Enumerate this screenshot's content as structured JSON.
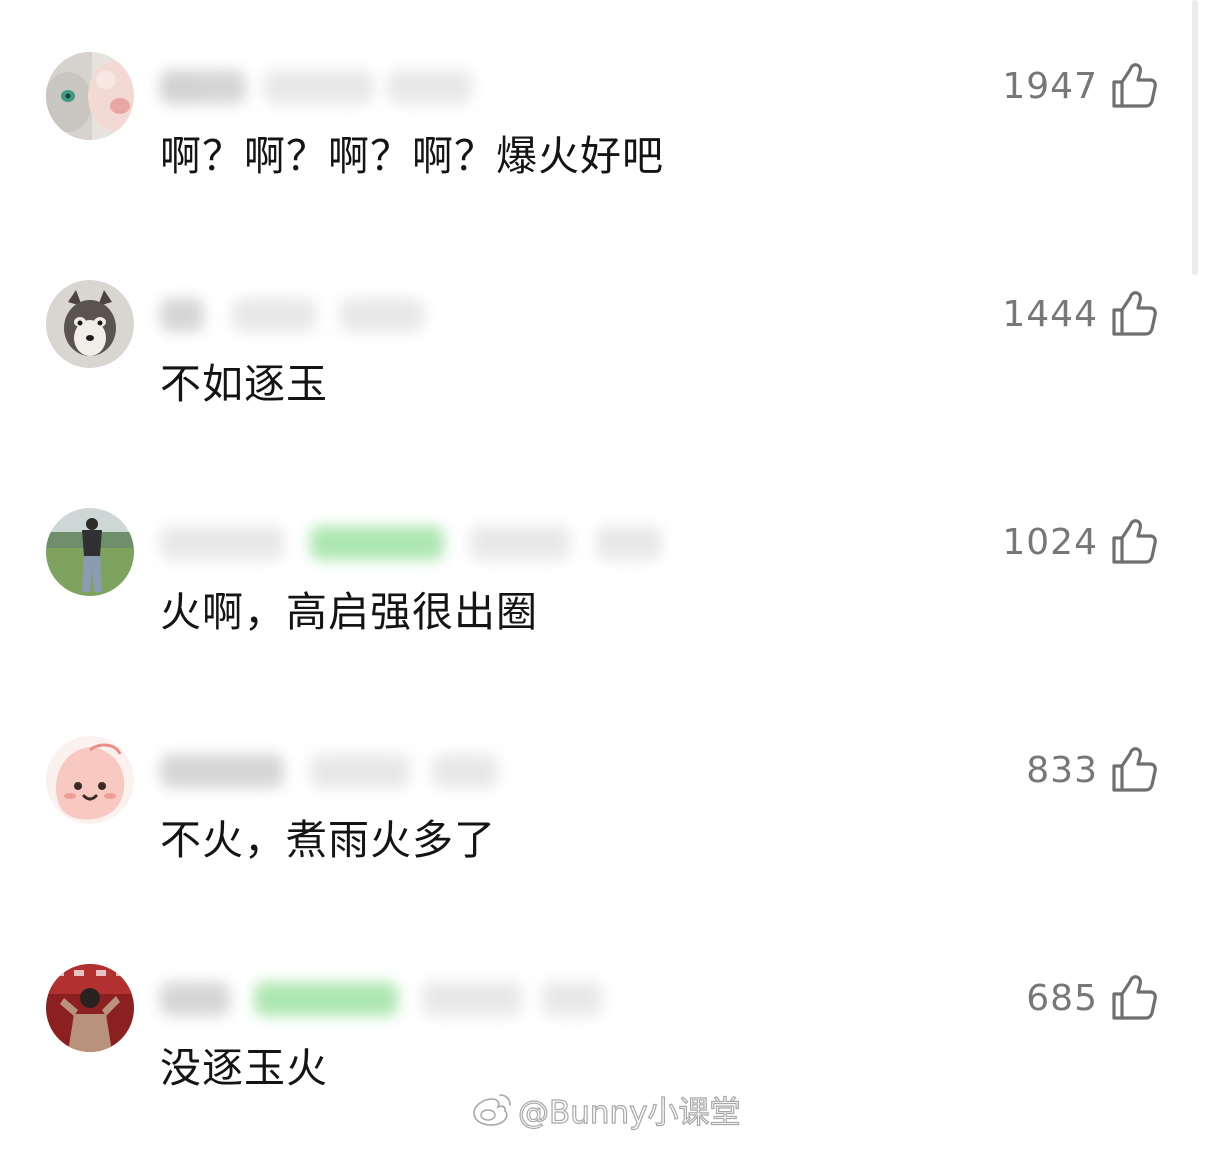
{
  "comments": [
    {
      "text": "啊？啊？啊？啊？爆火好吧",
      "likes": "1947",
      "avatar": "cat-avatar"
    },
    {
      "text": "不如逐玉",
      "likes": "1444",
      "avatar": "husky-avatar"
    },
    {
      "text": "火啊，高启强很出圈",
      "likes": "1024",
      "avatar": "person-on-grass-avatar"
    },
    {
      "text": "不火，煮雨火多了",
      "likes": "833",
      "avatar": "peach-cartoon-avatar"
    },
    {
      "text": "没逐玉火",
      "likes": "685",
      "avatar": "performer-avatar"
    }
  ],
  "like_icon": "thumbs-up-icon",
  "watermark": {
    "icon": "weibo-logo-icon",
    "text": "@Bunny小课堂"
  },
  "colors": {
    "text": "#141414",
    "like_count": "#777777",
    "like_icon": "#6f6f6f",
    "background": "#ffffff"
  }
}
